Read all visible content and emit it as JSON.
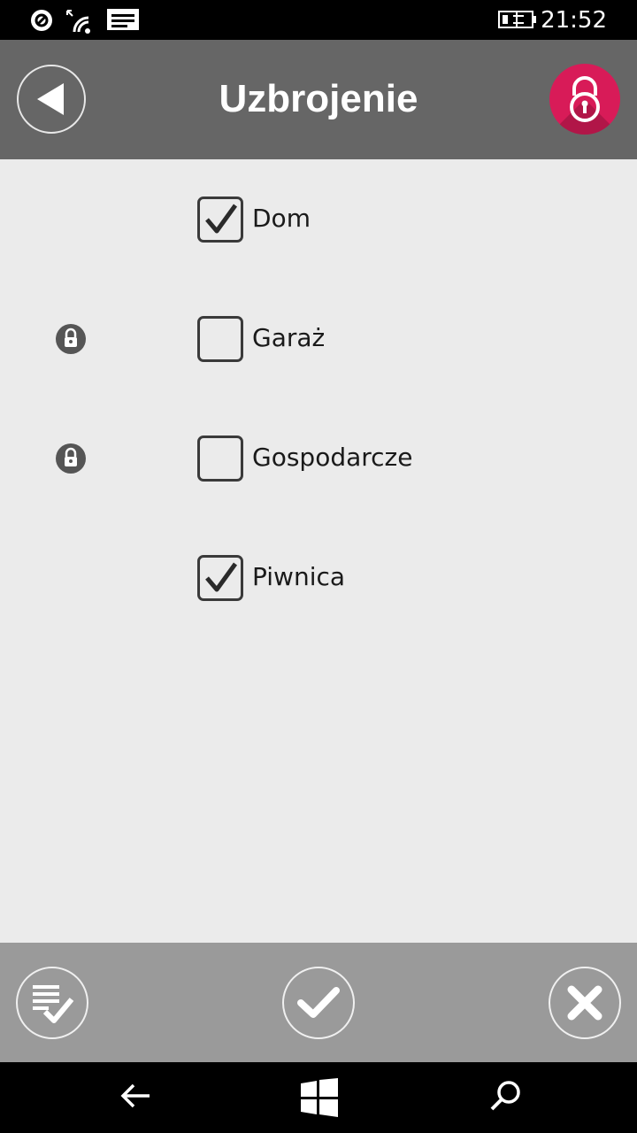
{
  "status_bar": {
    "time": "21:52",
    "icons": [
      "data-sense-icon",
      "wifi-icon",
      "message-icon",
      "battery-charging-icon"
    ]
  },
  "header": {
    "title": "Uzbrojenie",
    "back_icon": "back-arrow-icon",
    "action_icon": "padlock-icon",
    "action_color": "#d81b58"
  },
  "partitions": [
    {
      "label": "Dom",
      "checked": true,
      "locked": false
    },
    {
      "label": "Garaż",
      "checked": false,
      "locked": true
    },
    {
      "label": "Gospodarcze",
      "checked": false,
      "locked": true
    },
    {
      "label": "Piwnica",
      "checked": true,
      "locked": false
    }
  ],
  "app_bar": {
    "buttons": [
      "select-all-icon",
      "confirm-icon",
      "cancel-icon"
    ]
  },
  "nav_bar": {
    "buttons": [
      "back-icon",
      "windows-start-icon",
      "search-icon"
    ]
  }
}
